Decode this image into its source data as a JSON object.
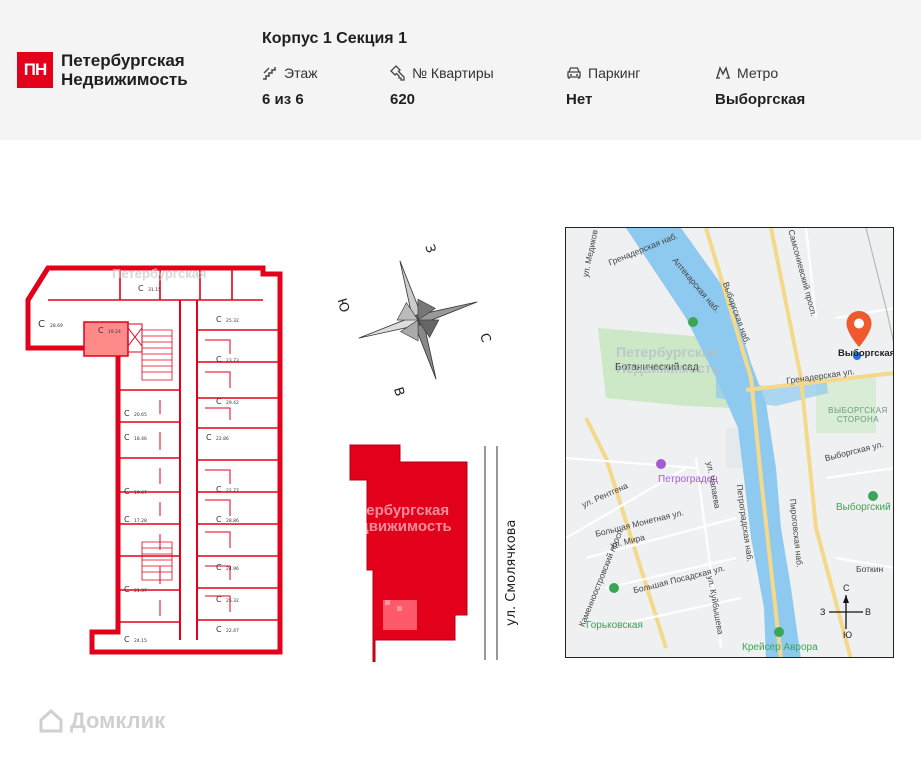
{
  "brand": {
    "logo_mark": "ПН",
    "name_line1": "Петербургская",
    "name_line2": "Недвижимость",
    "accent": "#e3001b"
  },
  "header": {
    "title": "Корпус 1 Секция 1",
    "fields": [
      {
        "label": "Этаж",
        "value": "6 из 6",
        "icon": "stairs-icon"
      },
      {
        "label": "№ Квартиры",
        "value": "620",
        "icon": "key-icon"
      },
      {
        "label": "Паркинг",
        "value": "Нет",
        "icon": "car-icon"
      },
      {
        "label": "Метро",
        "value": "Выборгская",
        "icon": "metro-icon"
      }
    ]
  },
  "plan": {
    "unit_letter": "С",
    "areas": [
      "28.69",
      "19.24",
      "31.15",
      "25.32",
      "23.73",
      "20.65",
      "29.42",
      "18.46",
      "22.86",
      "19.67",
      "22.77",
      "17.28",
      "28.86",
      "24.96",
      "21.37",
      "25.32",
      "24.15",
      "22.47"
    ]
  },
  "compass": {
    "north": "З",
    "south": "В",
    "east": "С",
    "west": "Ю"
  },
  "site": {
    "street": "ул. Смолячкова"
  },
  "map": {
    "labels": {
      "medikov": "ул. Медиков",
      "grenader_emb": "Гренадерская наб.",
      "aptekar_emb": "Аптекарская наб.",
      "vyborg_emb": "Выборгская наб.",
      "sampson": "Самсониевский просп.",
      "bot_garden": "Ботанический сад",
      "grenader_st": "Гренадерская ул.",
      "district": "ВЫБОРГСКАЯ СТОРОНА",
      "vyborg_st": "Выборгская ул.",
      "petrogradets": "Петроградец",
      "rentgena": "ул. Рентгена",
      "chapaeva": "ул. Чапаева",
      "petrograd_emb": "Петроградская наб.",
      "pirogov_emb": "Пироговская наб.",
      "b_monetnaya": "Большая Монетная ул.",
      "kamennoostr": "Каменноостровский просп.",
      "mira": "ул. Мира",
      "b_posadskaya": "Большая Посадская ул.",
      "kuybysheva": "ул. Куйбышева",
      "vyborgsky": "Выборгский",
      "botkin": "Боткин",
      "gorkovskaya": "Горьковская",
      "avrora": "Крейсер Аврора",
      "metro_vyborgskaya": "Выборгская"
    },
    "compass": {
      "n": "С",
      "s": "Ю",
      "w": "З",
      "e": "В"
    }
  },
  "watermark": {
    "line1": "Петербургская",
    "line2": "Недвижимость",
    "site_line1": "Петербургская",
    "site_line2": "Недвижимость",
    "domclick": "Домклик"
  }
}
